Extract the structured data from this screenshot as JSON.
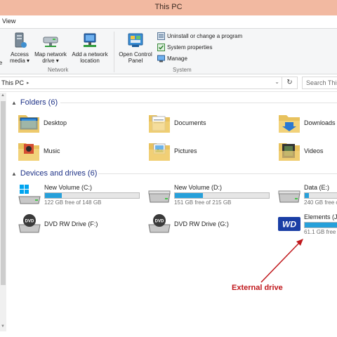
{
  "window": {
    "title": "This PC"
  },
  "menu": {
    "view_tab": "View"
  },
  "ribbon": {
    "network_group": {
      "label": "Network",
      "buttons": [
        {
          "label": "Access\nmedia ▾"
        },
        {
          "label": "Map network\ndrive ▾"
        },
        {
          "label": "Add a network\nlocation"
        }
      ]
    },
    "system_group": {
      "label": "System",
      "open_control_panel": "Open Control\nPanel",
      "uninstall": "Uninstall or change a program",
      "system_properties": "System properties",
      "manage": "Manage"
    }
  },
  "address": {
    "crumb": "This PC",
    "search_placeholder": "Search This"
  },
  "folders": {
    "header": "Folders (6)",
    "items": [
      {
        "name": "Desktop"
      },
      {
        "name": "Documents"
      },
      {
        "name": "Downloads"
      },
      {
        "name": "Music"
      },
      {
        "name": "Pictures"
      },
      {
        "name": "Videos"
      }
    ]
  },
  "devices": {
    "header": "Devices and drives (6)",
    "items": [
      {
        "name": "New Volume (C:)",
        "info": "122 GB free of 148 GB",
        "used_fraction": 0.18
      },
      {
        "name": "New Volume (D:)",
        "info": "151 GB free of 215 GB",
        "used_fraction": 0.3
      },
      {
        "name": "Data (E:)",
        "info": "240 GB free o",
        "used_fraction": 0.1
      },
      {
        "name": "DVD RW Drive (F:)"
      },
      {
        "name": "DVD RW Drive (G:)"
      },
      {
        "name": "Elements (J:)",
        "info": "61.1 GB free o",
        "used_fraction": 0.85,
        "logo_text": "WD"
      }
    ]
  },
  "annotation": {
    "text": "External drive",
    "color": "#c0181c"
  },
  "colors": {
    "title_bar": "#f2b9a1",
    "drive_fill": "#26a0da",
    "header_text": "#1e3287"
  }
}
